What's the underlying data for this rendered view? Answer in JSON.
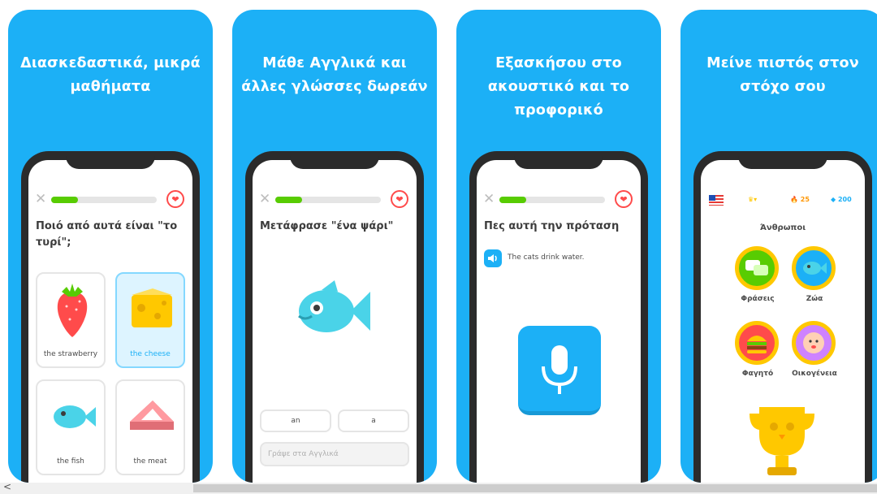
{
  "cards": [
    {
      "title": "Διασκεδαστικά, μικρά μαθήματα",
      "progress": 0.25,
      "question": "Ποιό από αυτά είναι \"το τυρί\";",
      "options": [
        "the strawberry",
        "the cheese",
        "the fish",
        "the meat"
      ],
      "selected": "the cheese"
    },
    {
      "title": "Μάθε Αγγλικά και άλλες γλώσσες δωρεάν",
      "progress": 0.25,
      "question": "Μετάφρασε \"ένα ψάρι\"",
      "word_chips": [
        "an",
        "a"
      ],
      "answer_placeholder": "Γράψε στα Αγγλικά"
    },
    {
      "title": "Εξασκήσου στο ακουστικό και το προφορικό",
      "progress": 0.25,
      "question": "Πες αυτή την πρόταση",
      "sentence": "The cats drink water."
    },
    {
      "title": "Μείνε πιστός στον στόχο σου",
      "stats": {
        "streak": "25",
        "gems": "200"
      },
      "unit_title": "Άνθρωποι",
      "skills": [
        "Φράσεις",
        "Ζώα",
        "Φαγητό",
        "Οικογένεια"
      ]
    }
  ],
  "colors": {
    "brand_blue": "#1cb0f6",
    "green": "#58cc02",
    "red": "#ff4b4b",
    "gold": "#ffc800"
  },
  "scrollbar": {
    "left_arrow": "<"
  }
}
